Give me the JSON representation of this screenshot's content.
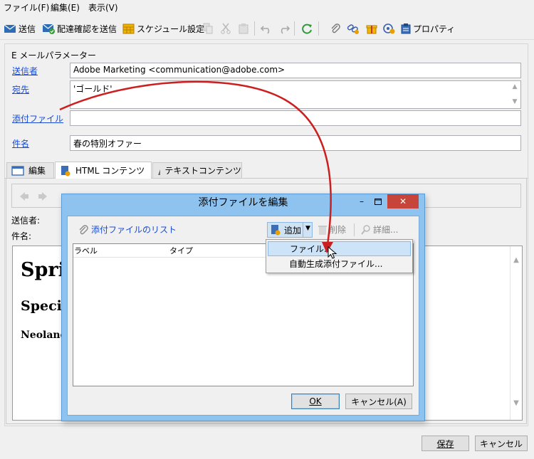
{
  "menu": {
    "file": "ファイル(F)",
    "edit": "編集(E)",
    "view": "表示(V)"
  },
  "toolbar": {
    "send": "送信",
    "send_proof": "配達確認を送信",
    "schedule": "スケジュール設定",
    "properties": "プロパティ"
  },
  "params": {
    "group_title": "E メールパラメーター",
    "sender_label": "送信者",
    "sender_value": "Adobe Marketing <communication@adobe.com>",
    "to_label": "宛先",
    "to_value": "'ゴールド'",
    "attach_label": "添付ファイル",
    "attach_value": "",
    "subject_label": "件名",
    "subject_value": "春の特別オファー"
  },
  "tabs": {
    "edit": "編集",
    "html": "HTML コンテンツ",
    "text": "テキストコンテンツ"
  },
  "editor": {
    "sender_label": "送信者:",
    "subject_label": "件名:",
    "heading1": "Spri",
    "heading2": "Specia",
    "heading3": "Neolanc"
  },
  "footer": {
    "save": "保存",
    "cancel": "キャンセル"
  },
  "dialog": {
    "title": "添付ファイルを編集",
    "list_link": "添付ファイルのリスト",
    "add": "追加",
    "delete": "削除",
    "details": "詳細...",
    "col_label": "ラベル",
    "col_type": "タイプ",
    "ok": "OK",
    "cancel": "キャンセル(A)",
    "menu": {
      "file": "ファイル...",
      "auto": "自動生成添付ファイル..."
    }
  },
  "colors": {
    "link": "#1a4bd1",
    "dialog_frame": "#8ec3ef",
    "close": "#c7443a",
    "arrow": "#cc1f1f"
  }
}
